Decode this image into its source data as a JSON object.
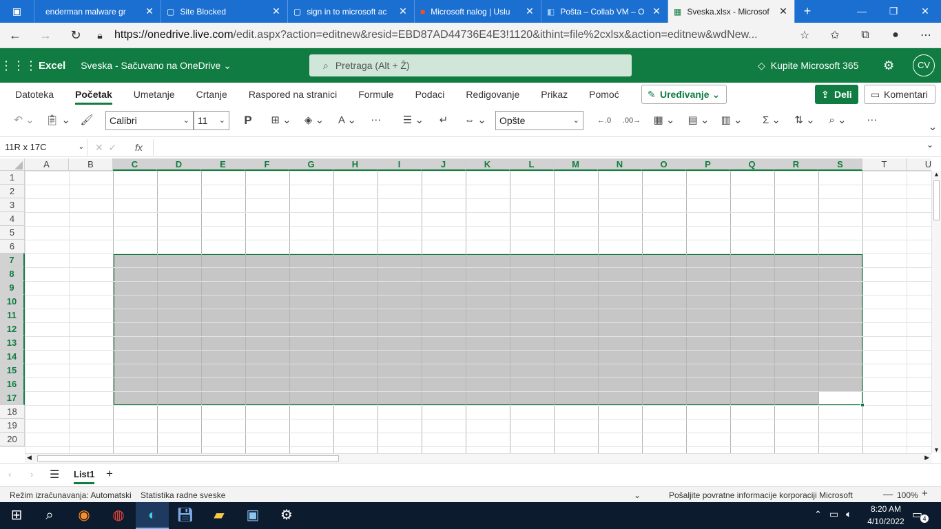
{
  "browser": {
    "tabs": [
      {
        "title": "enderman malware gr",
        "icon": "page-icon"
      },
      {
        "title": "Site Blocked",
        "icon": "page-icon"
      },
      {
        "title": "sign in to microsoft ac",
        "icon": "page-icon"
      },
      {
        "title": "Microsoft nalog | Uslu",
        "icon": "microsoft-icon"
      },
      {
        "title": "Pošta – Collab VM – O",
        "icon": "outlook-icon"
      },
      {
        "title": "Sveska.xlsx - Microsof",
        "icon": "excel-icon",
        "active": true
      }
    ],
    "url_host": "https://onedrive.live.com",
    "url_rest": "/edit.aspx?action=editnew&resid=EBD87AD44736E4E3!1120&ithint=file%2cxlsx&action=editnew&wdNew..."
  },
  "excel": {
    "app_name": "Excel",
    "doc_title": "Sveska - Sačuvano na OneDrive ⌄",
    "search_placeholder": "Pretraga (Alt + Ž)",
    "buy_label": "Kupite Microsoft 365",
    "avatar_initials": "CV",
    "ribbon_tabs": [
      "Datoteka",
      "Početak",
      "Umetanje",
      "Crtanje",
      "Raspored na stranici",
      "Formule",
      "Podaci",
      "Redigovanje",
      "Prikaz",
      "Pomoć"
    ],
    "active_tab": "Početak",
    "edit_mode_label": "Uređivanje",
    "share_label": "Deli",
    "comments_label": "Komentari",
    "font_name": "Calibri",
    "font_size": "11",
    "bold_label": "P",
    "number_format": "Opšte",
    "name_box": "11R x 17C",
    "fx_label": "fx",
    "columns": [
      "A",
      "B",
      "C",
      "D",
      "E",
      "F",
      "G",
      "H",
      "I",
      "J",
      "K",
      "L",
      "M",
      "N",
      "O",
      "P",
      "Q",
      "R",
      "S",
      "T",
      "U"
    ],
    "rows": [
      "1",
      "2",
      "3",
      "4",
      "5",
      "6",
      "7",
      "8",
      "9",
      "10",
      "11",
      "12",
      "13",
      "14",
      "15",
      "16",
      "17",
      "18",
      "19",
      "20"
    ],
    "selection": {
      "start_col": "C",
      "end_col": "S",
      "start_row": "7",
      "end_row": "17"
    },
    "sheet_name": "List1",
    "status_calc": "Režim izračunavanja: Automatski",
    "status_stats": "Statistika radne sveske",
    "status_feedback": "Pošaljite povratne informacije korporaciji Microsoft",
    "zoom": "100%",
    "accent_color": "#107c41"
  },
  "taskbar": {
    "time": "8:20 AM",
    "date": "4/10/2022",
    "notification_count": "4"
  }
}
